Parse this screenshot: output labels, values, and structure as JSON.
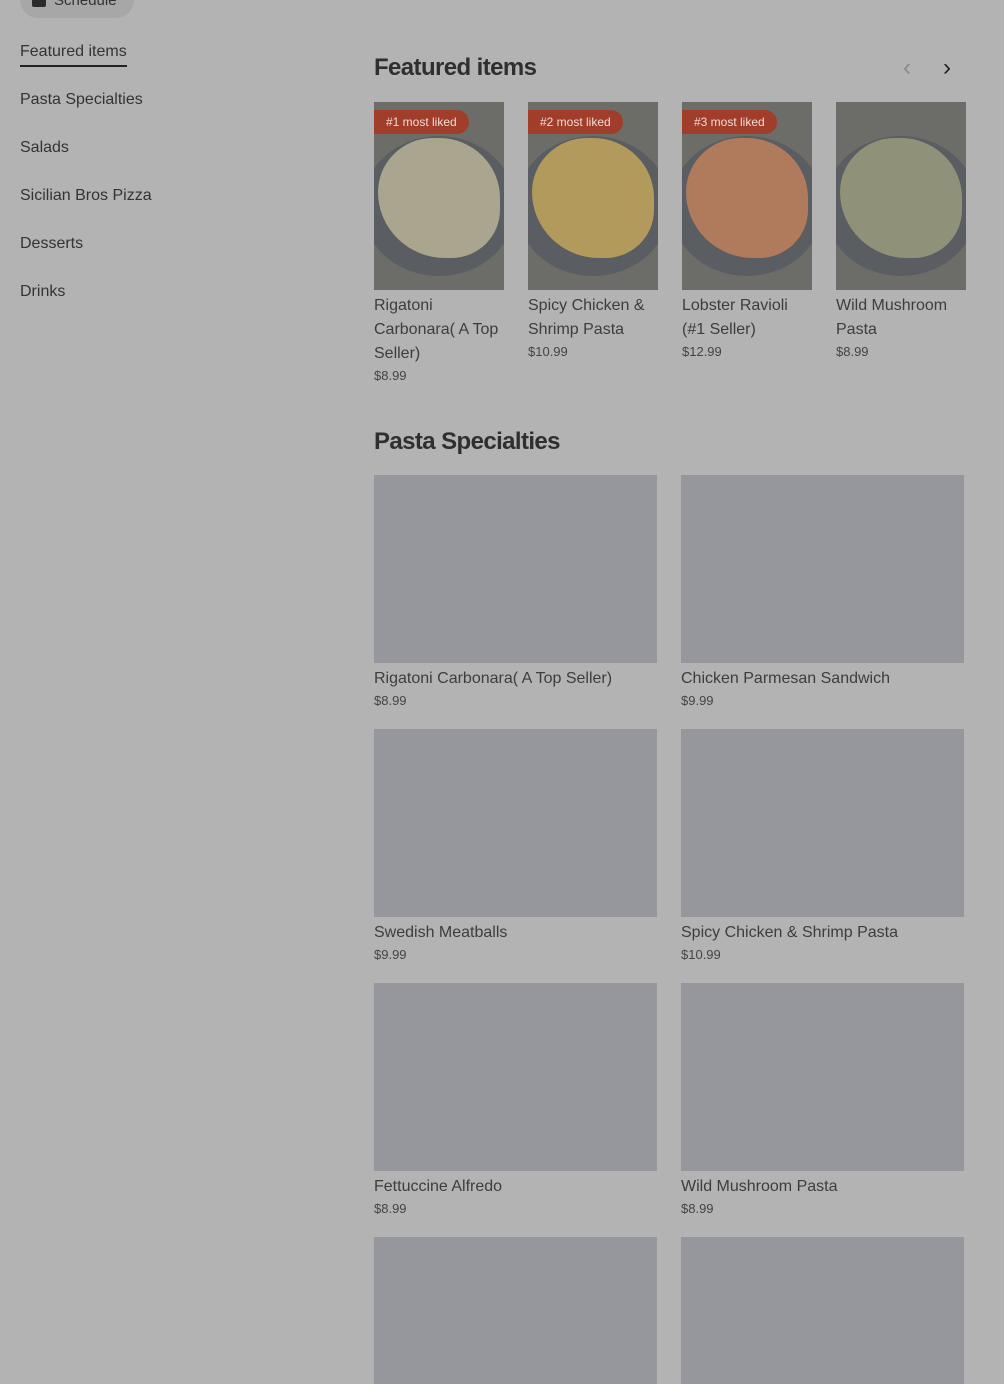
{
  "schedule": {
    "label": "Schedule"
  },
  "sidebar": {
    "items": [
      {
        "label": "Featured items",
        "active": true
      },
      {
        "label": "Pasta Specialties"
      },
      {
        "label": "Salads"
      },
      {
        "label": "Sicilian Bros Pizza"
      },
      {
        "label": "Desserts"
      },
      {
        "label": "Drinks"
      }
    ]
  },
  "featured": {
    "title": "Featured items",
    "prev_icon": "chevron-left-icon",
    "next_icon": "chevron-right-icon",
    "items": [
      {
        "badge": "#1 most liked",
        "name": "Rigatoni Carbonara( A Top Seller)",
        "price": "$8.99",
        "food_color": "#a9a58f"
      },
      {
        "badge": "#2 most liked",
        "name": "Spicy Chicken & Shrimp Pasta",
        "price": "$10.99",
        "food_color": "#b29a5c"
      },
      {
        "badge": "#3 most liked",
        "name": "Lobster Ravioli (#1 Seller)",
        "price": "$12.99",
        "food_color": "#b07b5c"
      },
      {
        "badge": "",
        "name": "Wild Mushroom Pasta",
        "price": "$8.99",
        "food_color": "#8f9278"
      }
    ]
  },
  "pasta": {
    "title": "Pasta Specialties",
    "items": [
      {
        "name": "Rigatoni Carbonara( A Top Seller)",
        "price": "$8.99"
      },
      {
        "name": "Chicken Parmesan Sandwich",
        "price": "$9.99"
      },
      {
        "name": "Swedish Meatballs",
        "price": "$9.99"
      },
      {
        "name": "Spicy Chicken & Shrimp Pasta",
        "price": "$10.99"
      },
      {
        "name": "Fettuccine Alfredo",
        "price": "$8.99"
      },
      {
        "name": "Wild Mushroom Pasta",
        "price": "$8.99"
      },
      {
        "name": "",
        "price": ""
      },
      {
        "name": "",
        "price": ""
      }
    ]
  }
}
